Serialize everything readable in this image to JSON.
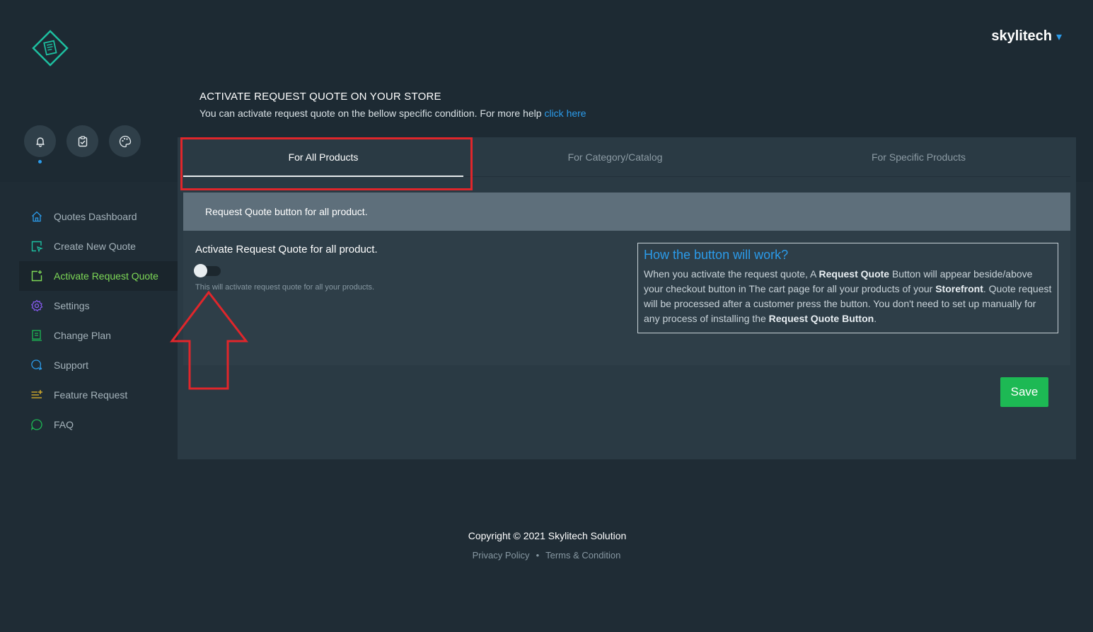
{
  "header": {
    "username": "skylitech",
    "caret": "▾"
  },
  "quick_icons": [
    "bell-icon",
    "clipboard-check-icon",
    "palette-icon"
  ],
  "sidebar": {
    "items": [
      {
        "label": "Quotes Dashboard",
        "icon": "home-icon",
        "color": "#2b9bea"
      },
      {
        "label": "Create New Quote",
        "icon": "create-quote-icon",
        "color": "#1dbfa0"
      },
      {
        "label": "Activate Request Quote",
        "icon": "activate-quote-icon",
        "color": "#7ed957"
      },
      {
        "label": "Settings",
        "icon": "gear-icon",
        "color": "#8a5cf6"
      },
      {
        "label": "Change Plan",
        "icon": "plan-icon",
        "color": "#1db954"
      },
      {
        "label": "Support",
        "icon": "support-chat-icon",
        "color": "#2b9bea"
      },
      {
        "label": "Feature Request",
        "icon": "feature-list-icon",
        "color": "#e5b829"
      },
      {
        "label": "FAQ",
        "icon": "faq-bubble-icon",
        "color": "#1db954"
      }
    ],
    "active": "Activate Request Quote"
  },
  "intro": {
    "title": "ACTIVATE REQUEST QUOTE ON YOUR STORE",
    "subtitle": "You can activate request quote on the bellow specific condition. For more help ",
    "link": "click here"
  },
  "tabs": [
    {
      "label": "For All Products",
      "active": true
    },
    {
      "label": "For Category/Catalog",
      "active": false
    },
    {
      "label": "For Specific Products",
      "active": false
    }
  ],
  "banner": "Request Quote button for all product.",
  "option": {
    "label": "Activate Request Quote for all product.",
    "enabled": false,
    "help": "This will activate request quote for all your products."
  },
  "info": {
    "title": "How the button will work?",
    "t1": "When you activate the request quote, A ",
    "b1": "Request Quote",
    "t2": " Button will appear beside/above your checkout button in The cart page for all your products of your ",
    "b2": "Storefront",
    "t3": ". Quote request will be processed after a customer press the button. You don't need to set up manually for any process of installing the ",
    "b3": "Request Quote Button",
    "t4": "."
  },
  "save_label": "Save",
  "footer": {
    "copyright": "Copyright © 2021 Skylitech Solution",
    "privacy": "Privacy Policy",
    "separator": "•",
    "terms": "Terms & Condition"
  },
  "colors": {
    "accent": "#2b9bea",
    "active_nav": "#7ed957",
    "save": "#1db954",
    "highlight": "#e0262b"
  }
}
